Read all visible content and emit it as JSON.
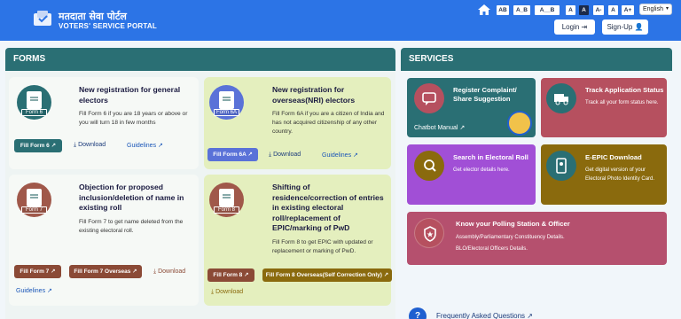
{
  "header": {
    "brand_hindi": "मतदाता सेवा पोर्टल",
    "brand_english": "VOTERS' SERVICE PORTAL",
    "font_buttons": [
      "AB",
      "A_B",
      "A__B",
      "A",
      "A",
      "A-",
      "A",
      "A+"
    ],
    "language": "English",
    "login_label": "Login",
    "signup_label": "Sign-Up"
  },
  "forms": {
    "section_title": "FORMS",
    "cards": [
      {
        "tag": "Form 6",
        "title": "New registration for general electors",
        "desc": "Fill Form 6 if you are 18 years or above or you will turn 18 in few months",
        "fill_label": "Fill Form 6",
        "download_label": "Download",
        "guidelines_label": "Guidelines"
      },
      {
        "tag": "Form 6A",
        "title": "New registration for overseas(NRI) electors",
        "desc": "Fill Form 6A if you are a citizen of India and has not acquired citizenship of any other country.",
        "fill_label": "Fill Form 6A",
        "download_label": "Download",
        "guidelines_label": "Guidelines"
      },
      {
        "tag": "Form 7",
        "title": "Objection for proposed inclusion/deletion of name in existing roll",
        "desc": "Fill Form 7 to get name deleted from the existing electoral roll.",
        "fill_label": "Fill Form 7",
        "overseas_label": "Fill Form 7 Overseas",
        "download_label": "Download",
        "guidelines_label": "Guidelines"
      },
      {
        "tag": "Form 8",
        "title": "Shifting of residence/correction of entries in existing electoral roll/replacement of EPIC/marking of PwD",
        "desc": "Fill Form 8 to get EPIC with updated or replacement or marking of PwD.",
        "fill_label": "Fill Form 8",
        "overseas_label": "Fill Form 8 Overseas(Self Correction Only)",
        "download_label": "Download"
      }
    ]
  },
  "services": {
    "section_title": "SERVICES",
    "cards": [
      {
        "title": "Register Complaint/ Share Suggestion",
        "desc": "",
        "extra": "Chatbot Manual",
        "color": "#2a6f74"
      },
      {
        "title": "Track Application Status",
        "desc": "Track all your form status here.",
        "color": "#b6505f"
      },
      {
        "title": "Search in Electoral Roll",
        "desc": "Get elector details here.",
        "color": "#a14fd6"
      },
      {
        "title": "E-EPIC Download",
        "desc": "Get digital version of your Electoral Photo Identity Card.",
        "color": "#8a6a0d"
      },
      {
        "title": "Know your Polling Station & Officer",
        "desc": "Assembly/Parliamentary Constituency Details.",
        "desc2": "BLO/Electoral Officers Details.",
        "color": "#b5506e"
      }
    ]
  },
  "faq": {
    "label": "Frequently Asked Questions"
  },
  "colors": {
    "header": "#2c74e6",
    "section_bar": "#2a6f74",
    "form_button_teal": "#2a6f74",
    "form_button_brown": "#8b4a36",
    "form_button_blue": "#5a72d8",
    "form_button_olive": "#8a6a0d"
  }
}
